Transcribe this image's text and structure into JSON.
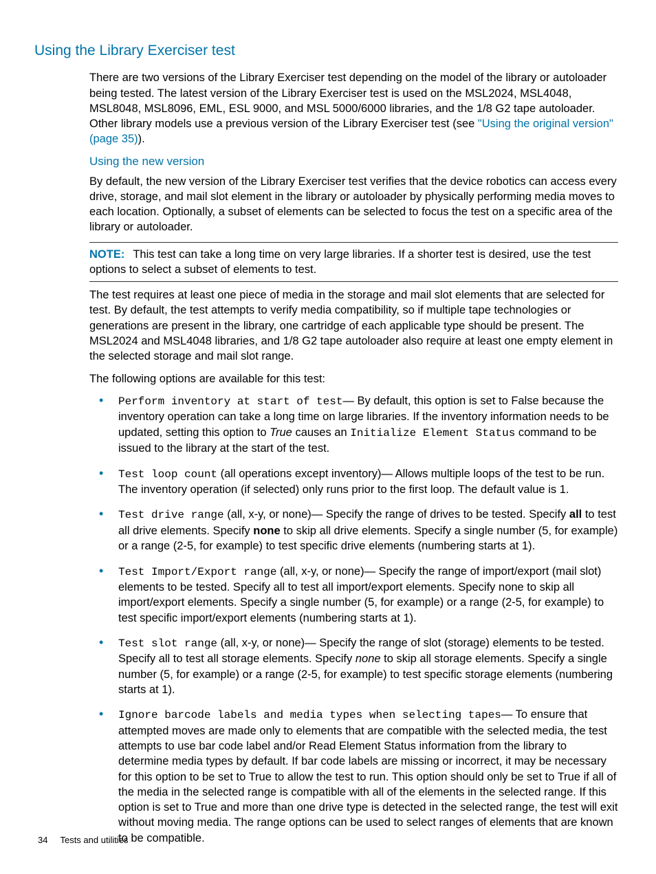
{
  "heading1": "Using the Library Exerciser test",
  "intro_pre": "There are two versions of the Library Exerciser test depending on the model of the library or autoloader being tested. The latest version of the Library Exerciser test is used on the MSL2024, MSL4048, MSL8048, MSL8096, EML, ESL 9000, and MSL 5000/6000 libraries, and the 1/8 G2 tape autoloader. Other library models use a previous version of the Library Exerciser test (see ",
  "intro_link": "\"Using the original version\" (page 35)",
  "intro_post": ").",
  "heading2": "Using the new version",
  "para2": "By default, the new version of the Library Exerciser test verifies that the device robotics can access every drive, storage, and mail slot element in the library or autoloader by physically performing media moves to each location. Optionally, a subset of elements can be selected to focus the test on a specific area of the library or autoloader.",
  "note_label": "NOTE:",
  "note_text": "This test can take a long time on very large libraries. If a shorter test is desired, use the test options to select a subset of elements to test.",
  "para3": "The test requires at least one piece of media in the storage and mail slot elements that are selected for test. By default, the test attempts to verify media compatibility, so if multiple tape technologies or generations are present in the library, one cartridge of each applicable type should be present. The MSL2024 and MSL4048 libraries, and 1/8 G2 tape autoloader also require at least one empty element in the selected storage and mail slot range.",
  "para4": "The following options are available for this test:",
  "opt1_code": "Perform inventory at start of test",
  "opt1_a": "— By default, this option is set to False because the inventory operation can take a long time on large libraries. If the inventory information needs to be updated, setting this option to ",
  "opt1_true": "True",
  "opt1_b": " causes an ",
  "opt1_code2": "Initialize Element Status",
  "opt1_c": " command to be issued to the library at the start of the test.",
  "opt2_code": "Test loop count",
  "opt2_text": " (all operations except inventory)— Allows multiple loops of the test to be run. The inventory operation (if selected) only runs prior to the first loop. The default value is 1.",
  "opt3_code": "Test drive range",
  "opt3_a": " (all, x-y, or none)— Specify the range of drives to be tested. Specify ",
  "opt3_all": "all",
  "opt3_b": " to test all drive elements. Specify ",
  "opt3_none": "none",
  "opt3_c": " to skip all drive elements. Specify a single number (5, for example) or a range (2-5, for example) to test specific drive elements (numbering starts at 1).",
  "opt4_code": "Test Import/Export range",
  "opt4_text": " (all, x-y, or none)— Specify the range of import/export (mail slot) elements to be tested. Specify all to test all import/export elements. Specify none to skip all import/export elements. Specify a single number (5, for example) or a range (2-5, for example) to test specific import/export elements (numbering starts at 1).",
  "opt5_code": "Test slot range",
  "opt5_a": " (all, x-y, or none)— Specify the range of slot (storage) elements to be tested. Specify all to test all storage elements. Specify ",
  "opt5_none": "none",
  "opt5_b": " to skip all storage elements. Specify a single number (5, for example) or a range (2-5, for example) to test specific storage elements (numbering starts at 1).",
  "opt6_code": "Ignore barcode labels and media types when selecting tapes",
  "opt6_text": "— To ensure that attempted moves are made only to elements that are compatible with the selected media, the test attempts to use bar code label and/or Read Element Status information from the library to determine media types by default. If bar code labels are missing or incorrect, it may be necessary for this option to be set to True to allow the test to run. This option should only be set to True if all of the media in the selected range is compatible with all of the elements in the selected range. If this option is set to True and more than one drive type is detected in the selected range, the test will exit without moving media. The range options can be used to select ranges of elements that are known to be compatible.",
  "footer_page": "34",
  "footer_text": "Tests and utilities"
}
